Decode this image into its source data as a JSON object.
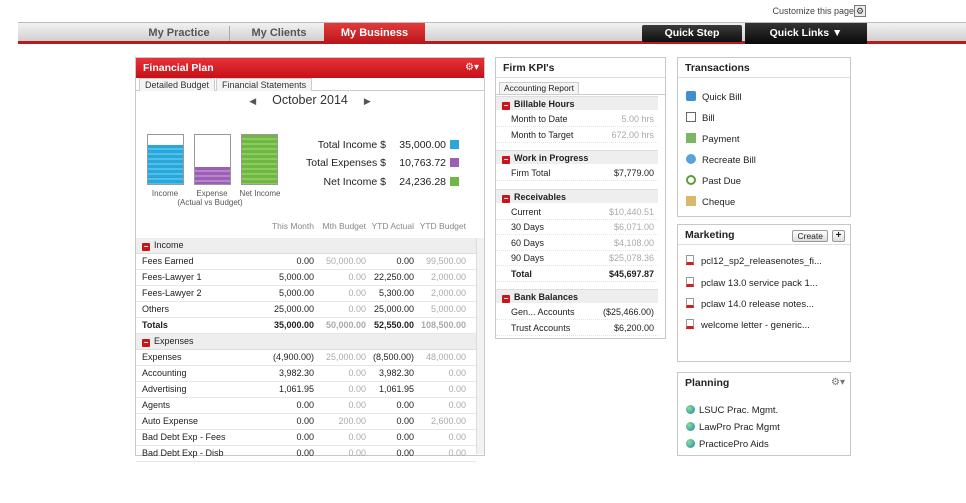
{
  "customize": {
    "label": "Customize this page"
  },
  "nav": {
    "tabs": [
      "My Practice",
      "My Clients",
      "My Business"
    ],
    "active": "My Business",
    "quick_step": "Quick Step",
    "quick_links": "Quick Links ▼"
  },
  "financial_plan": {
    "title": "Financial Plan",
    "subtabs": [
      "Detailed Budget",
      "Financial Statements"
    ],
    "month": "October 2014",
    "gauges": {
      "income_label": "Income",
      "expense_label": "Expense",
      "net_label": "Net Income",
      "caption": "(Actual vs Budget)",
      "income_fill": 0.8,
      "expense_fill": 0.35,
      "net_fill": 1.0
    },
    "totals": [
      {
        "label": "Total Income $",
        "value": "35,000.00"
      },
      {
        "label": "Total Expenses $",
        "value": "10,763.72"
      },
      {
        "label": "Net Income $",
        "value": "24,236.28"
      }
    ],
    "columns": [
      "This Month",
      "Mth Budget",
      "YTD Actual",
      "YTD Budget"
    ],
    "income_section": "Income",
    "income_rows": [
      {
        "name": "Fees Earned",
        "v": [
          "0.00",
          "50,000.00",
          "0.00",
          "99,500.00"
        ]
      },
      {
        "name": "Fees-Lawyer 1",
        "v": [
          "5,000.00",
          "0.00",
          "22,250.00",
          "2,000.00"
        ]
      },
      {
        "name": "Fees-Lawyer 2",
        "v": [
          "5,000.00",
          "0.00",
          "5,300.00",
          "2,000.00"
        ]
      },
      {
        "name": "Others",
        "v": [
          "25,000.00",
          "0.00",
          "25,000.00",
          "5,000.00"
        ]
      }
    ],
    "totals_row": {
      "name": "Totals",
      "v": [
        "35,000.00",
        "50,000.00",
        "52,550.00",
        "108,500.00"
      ]
    },
    "expenses_section": "Expenses",
    "expense_rows": [
      {
        "name": "Expenses",
        "v": [
          "(4,900.00)",
          "25,000.00",
          "(8,500.00)",
          "48,000.00"
        ]
      },
      {
        "name": "Accounting",
        "v": [
          "3,982.30",
          "0.00",
          "3,982.30",
          "0.00"
        ]
      },
      {
        "name": "Advertising",
        "v": [
          "1,061.95",
          "0.00",
          "1,061.95",
          "0.00"
        ]
      },
      {
        "name": "Agents",
        "v": [
          "0.00",
          "0.00",
          "0.00",
          "0.00"
        ]
      },
      {
        "name": "Auto Expense",
        "v": [
          "0.00",
          "200.00",
          "0.00",
          "2,600.00"
        ]
      },
      {
        "name": "Bad Debt Exp - Fees",
        "v": [
          "0.00",
          "0.00",
          "0.00",
          "0.00"
        ]
      },
      {
        "name": "Bad Debt Exp - Disb",
        "v": [
          "0.00",
          "0.00",
          "0.00",
          "0.00"
        ]
      }
    ]
  },
  "kpi": {
    "title": "Firm KPI's",
    "tab": "Accounting Report",
    "sections": [
      {
        "title": "Billable Hours",
        "rows": [
          {
            "label": "Month to Date",
            "value": "5.00 hrs"
          },
          {
            "label": "Month to Target",
            "value": "672.00 hrs"
          }
        ]
      },
      {
        "title": "Work in Progress",
        "rows": [
          {
            "label": "Firm Total",
            "value": "$7,779.00"
          }
        ]
      },
      {
        "title": "Receivables",
        "rows": [
          {
            "label": "Current",
            "value": "$10,440.51"
          },
          {
            "label": "30 Days",
            "value": "$6,071.00"
          },
          {
            "label": "60 Days",
            "value": "$4,108.00"
          },
          {
            "label": "90 Days",
            "value": "$25,078.36"
          },
          {
            "label": "Total",
            "value": "$45,697.87"
          }
        ]
      },
      {
        "title": "Bank Balances",
        "rows": [
          {
            "label": "Gen... Accounts",
            "value": "($25,466.00)"
          },
          {
            "label": "Trust Accounts",
            "value": "$6,200.00"
          }
        ]
      }
    ]
  },
  "transactions": {
    "title": "Transactions",
    "items": [
      "Quick Bill",
      "Bill",
      "Payment",
      "Recreate Bill",
      "Past Due",
      "Cheque"
    ]
  },
  "marketing": {
    "title": "Marketing",
    "create": "Create",
    "plus": "+",
    "items": [
      "pcl12_sp2_releasenotes_fi...",
      "pclaw 13.0 service pack 1...",
      "pclaw 14.0 release notes...",
      "welcome letter - generic..."
    ]
  },
  "planning": {
    "title": "Planning",
    "items": [
      "LSUC Prac. Mgmt.",
      "LawPro Prac Mgmt",
      "PracticePro Aids"
    ]
  },
  "colors": {
    "brand_red": "#c8141b",
    "income_blue": "#2aa6d8",
    "expense_purple": "#9b5fb5",
    "net_green": "#6fb642"
  }
}
